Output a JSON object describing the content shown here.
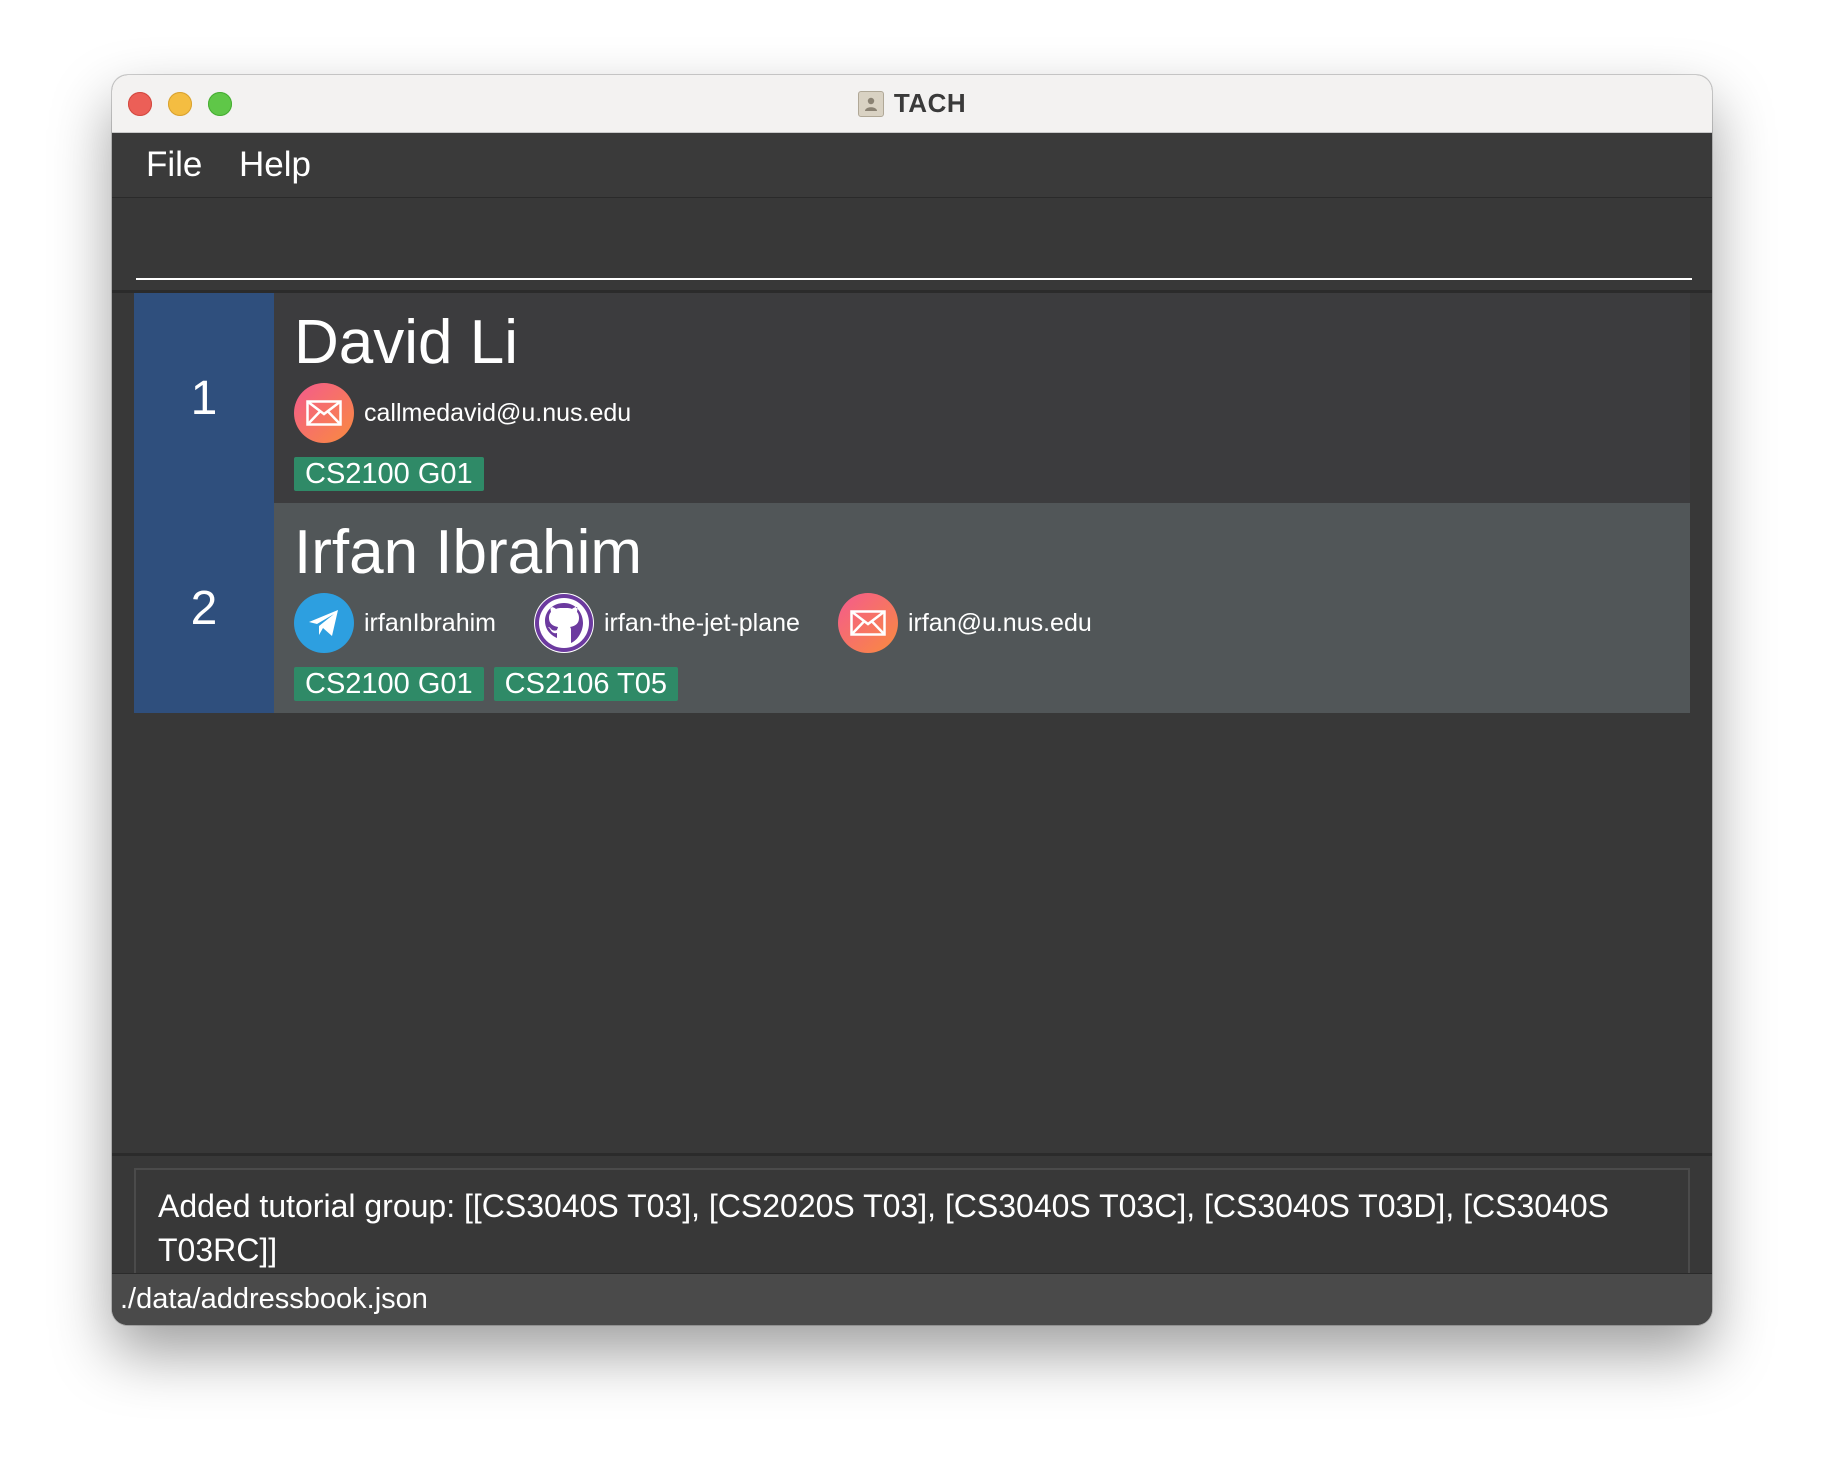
{
  "window": {
    "title": "TACH",
    "app_icon": "contact-card-icon"
  },
  "menu": {
    "file_label": "File",
    "help_label": "Help"
  },
  "command": {
    "value": "",
    "placeholder": ""
  },
  "persons": [
    {
      "index": "1",
      "name": "David Li",
      "contacts": [
        {
          "type": "email",
          "icon": "email-icon",
          "value": "callmedavid@u.nus.edu"
        }
      ],
      "tags": [
        "CS2100 G01"
      ]
    },
    {
      "index": "2",
      "name": "Irfan Ibrahim",
      "contacts": [
        {
          "type": "telegram",
          "icon": "telegram-icon",
          "value": "irfanIbrahim"
        },
        {
          "type": "github",
          "icon": "github-icon",
          "value": "irfan-the-jet-plane"
        },
        {
          "type": "email",
          "icon": "email-icon",
          "value": "irfan@u.nus.edu"
        }
      ],
      "tags": [
        "CS2100 G01",
        "CS2106 T05"
      ]
    }
  ],
  "result": {
    "message": "Added tutorial group: [[CS3040S T03], [CS2020S T03], [CS3040S T03C], [CS3040S T03D], [CS3040S T03RC]]"
  },
  "status": {
    "path": "./data/addressbook.json"
  },
  "colors": {
    "index_bg": "#2f4f7d",
    "tag_bg": "#2f8a67",
    "background": "#383838"
  }
}
